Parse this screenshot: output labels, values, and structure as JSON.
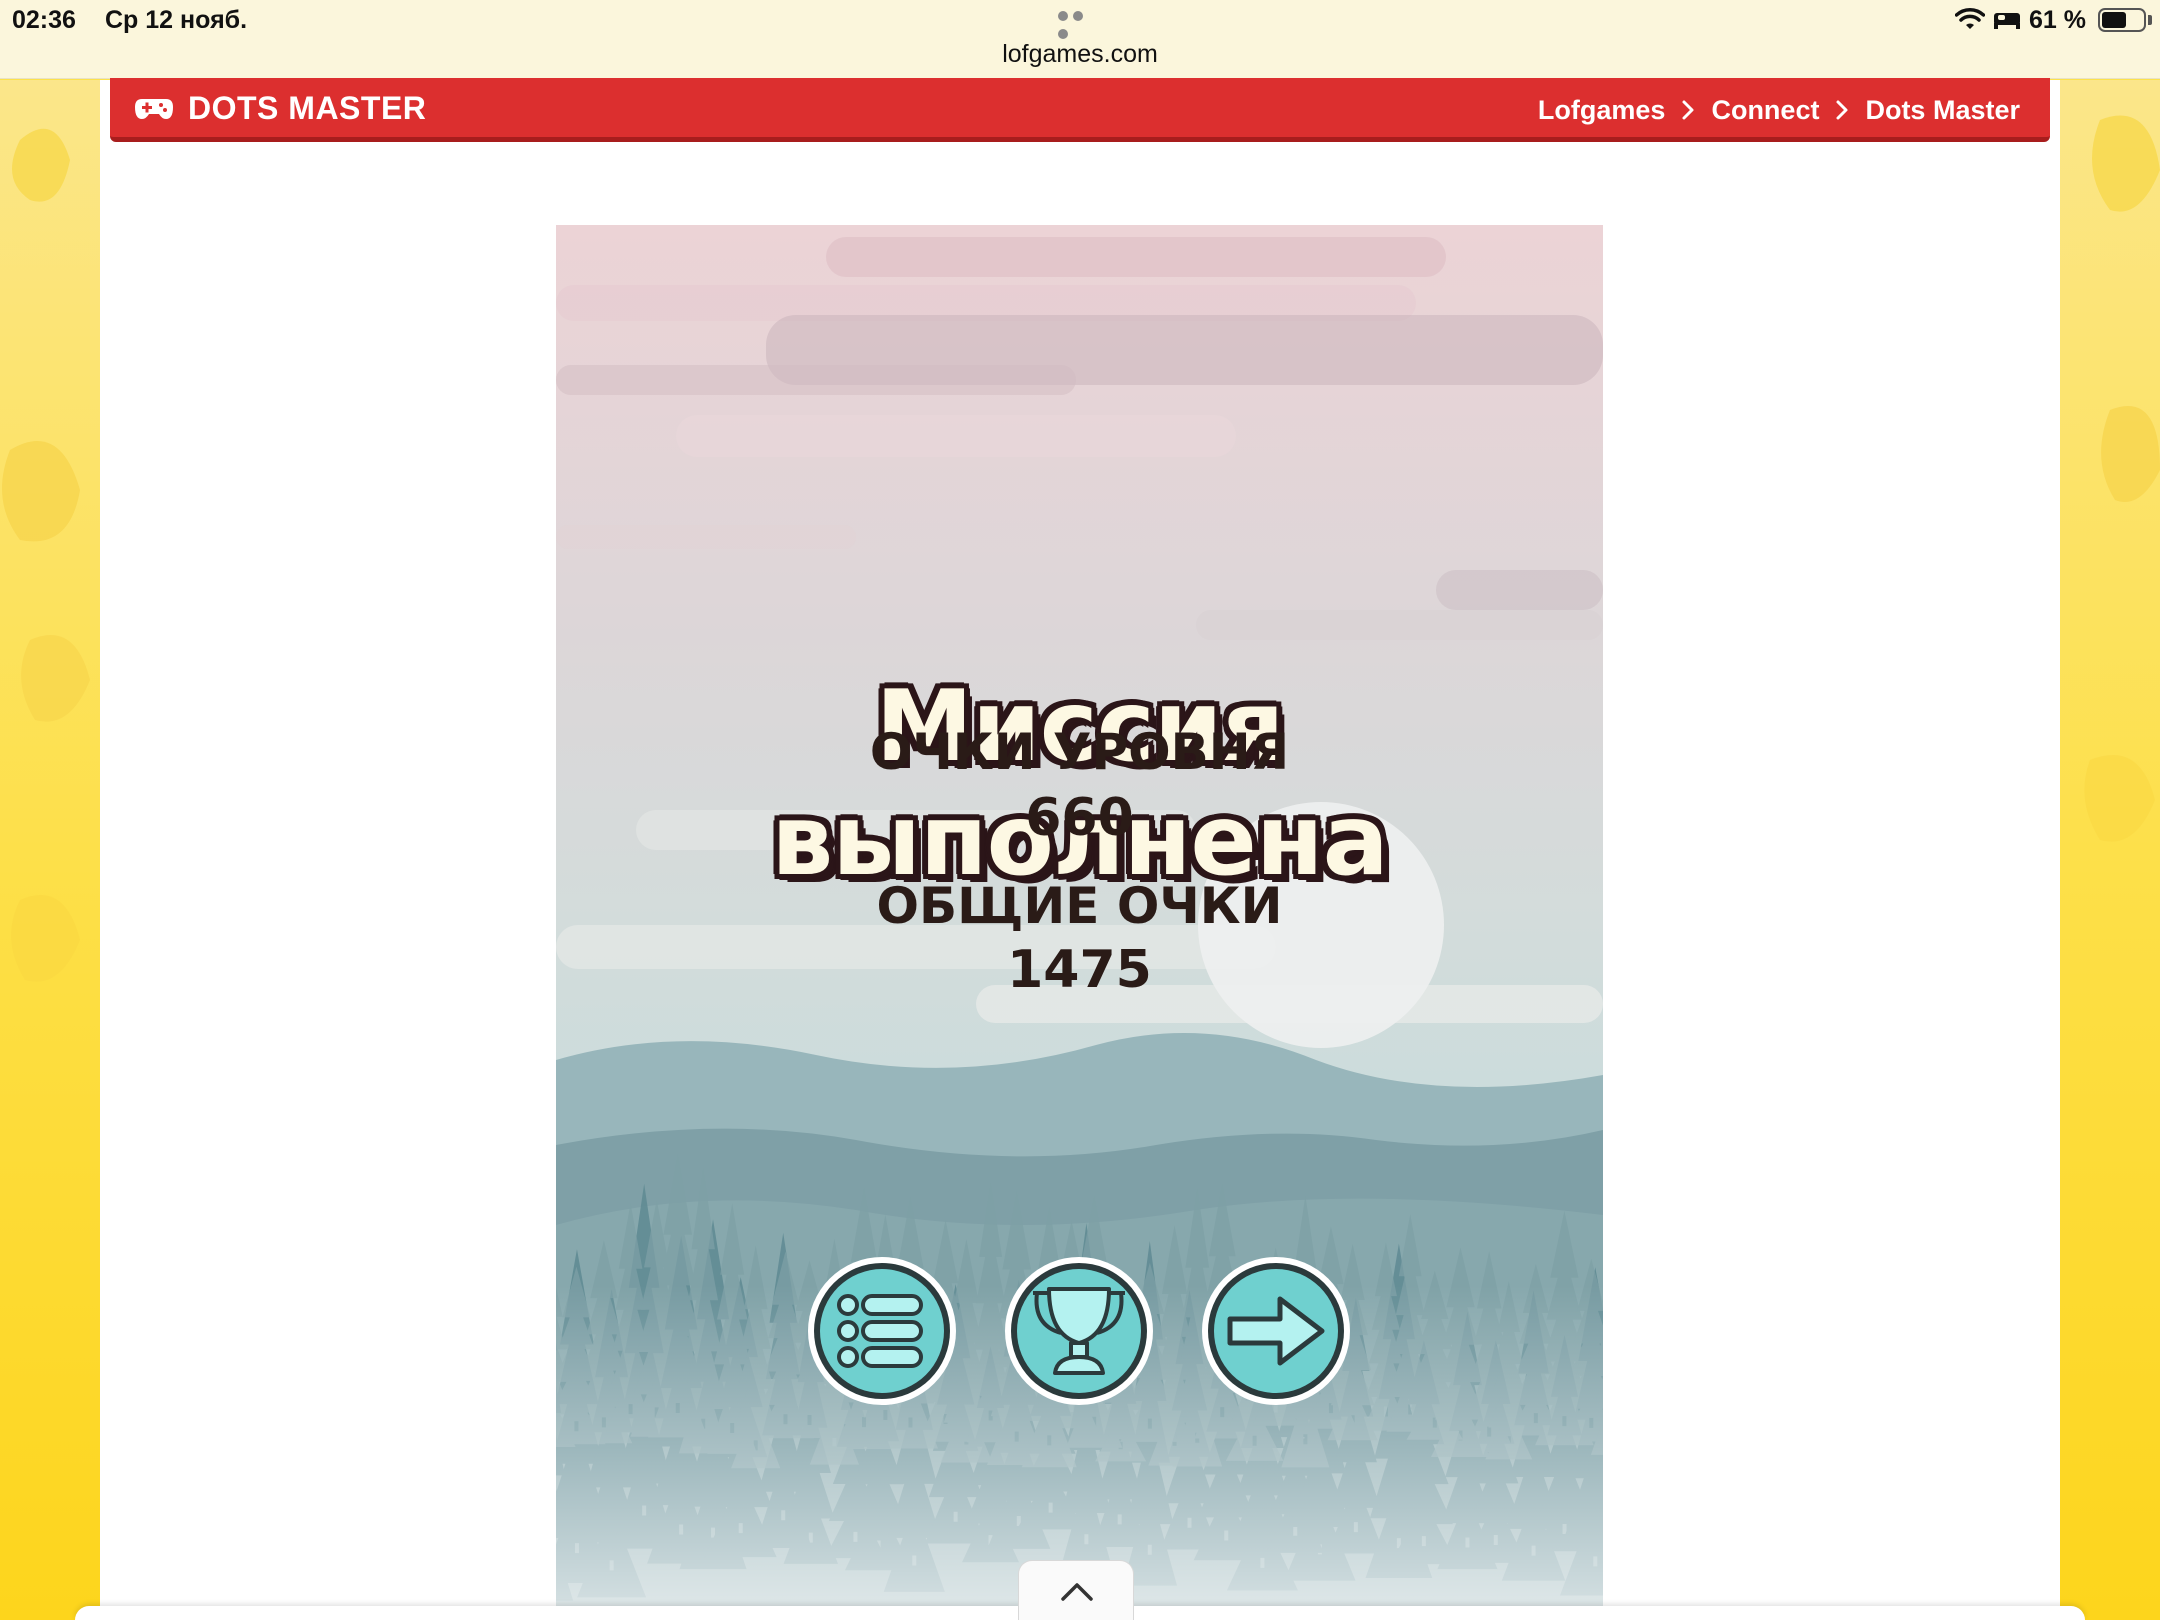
{
  "status_bar": {
    "time": "02:36",
    "date": "Ср 12 нояб.",
    "url": "lofgames.com",
    "battery": "61 %",
    "battery_level": 0.61
  },
  "header": {
    "title": "DOTS MASTER",
    "breadcrumb": [
      "Lofgames",
      "Connect",
      "Dots Master"
    ]
  },
  "game": {
    "title": "Миссия выполнена",
    "level_score_label": "ОЧКИ УРОВНЯ",
    "level_score": "660",
    "total_score_label": "ОБЩИЕ ОЧКИ",
    "total_score": "1475",
    "buttons": [
      "menu-icon",
      "trophy-icon",
      "arrow-right-icon"
    ]
  },
  "colors": {
    "header_red": "#dc2f2f",
    "page_yellow": "#fde24a",
    "button_teal": "#6fd0cf",
    "title_cream": "#fdf8e3",
    "score_dark": "#2a1b17"
  }
}
